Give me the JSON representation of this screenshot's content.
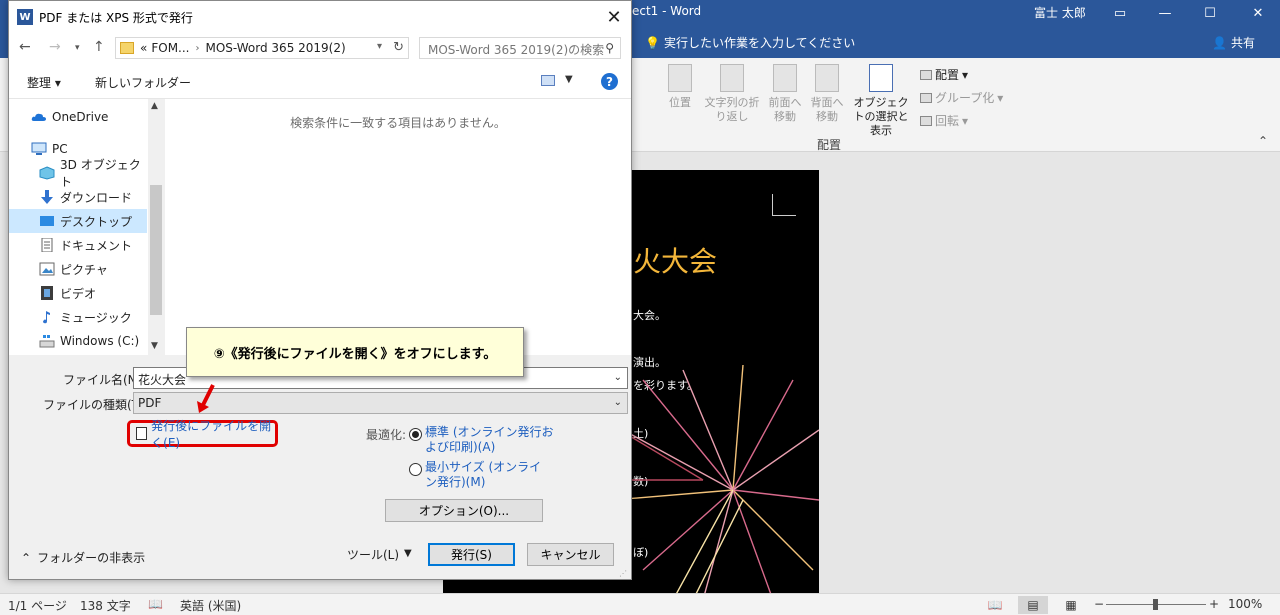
{
  "word": {
    "title": "ect1  -  Word",
    "user": "富士 太郎",
    "tell_me": "実行したい作業を入力してください",
    "share": "共有",
    "ribbon": {
      "position": "位置",
      "wrap_text": "文字列の折り返し",
      "bring_forward": "前面へ移動",
      "send_backward": "背面へ移動",
      "selection_pane": "オブジェクトの選択と表示",
      "align": "配置",
      "group": "グループ化",
      "rotate": "回転",
      "group_label": "配置"
    },
    "document": {
      "title": "火大会",
      "lines": [
        "大会。",
        "演出。",
        "を彩ります。",
        "土)",
        "数)",
        "ぼ)"
      ]
    },
    "status": {
      "page": "1/1 ページ",
      "words": "138 文字",
      "language": "英語 (米国)",
      "zoom": "100%"
    }
  },
  "dialog": {
    "title": "PDF または XPS 形式で発行",
    "address": {
      "prefix": "«",
      "crumb1": "FOM...",
      "crumb2": "MOS-Word 365 2019(2)"
    },
    "search_placeholder": "MOS-Word 365 2019(2)の検索",
    "toolbar": {
      "organize": "整理",
      "new_folder": "新しいフォルダー"
    },
    "tree": [
      {
        "label": "OneDrive",
        "icon": "cloud-icon"
      },
      {
        "label": "PC",
        "icon": "pc-icon"
      },
      {
        "label": "3D オブジェクト",
        "icon": "cube-icon"
      },
      {
        "label": "ダウンロード",
        "icon": "download-icon"
      },
      {
        "label": "デスクトップ",
        "icon": "desktop-icon"
      },
      {
        "label": "ドキュメント",
        "icon": "document-icon"
      },
      {
        "label": "ピクチャ",
        "icon": "picture-icon"
      },
      {
        "label": "ビデオ",
        "icon": "video-icon"
      },
      {
        "label": "ミュージック",
        "icon": "music-icon"
      },
      {
        "label": "Windows (C:)",
        "icon": "drive-icon"
      }
    ],
    "empty_message": "検索条件に一致する項目はありません。",
    "filename_label": "ファイル名(N):",
    "filename_value": "花火大会",
    "filetype_label": "ファイルの種類(T):",
    "filetype_value": "PDF",
    "open_after_publish": "発行後にファイルを開く(E)",
    "open_after_publish_checked": false,
    "optimize_label": "最適化:",
    "optimize_standard": "標準 (オンライン発行および印刷)(A)",
    "optimize_minimum": "最小サイズ (オンライン発行)(M)",
    "options_button": "オプション(O)...",
    "hide_folders": "フォルダーの非表示",
    "tools": "ツール(L)",
    "publish_button": "発行(S)",
    "cancel_button": "キャンセル"
  },
  "callout": {
    "text": "⑨《発行後にファイルを開く》をオフにします。"
  },
  "colors": {
    "word_blue": "#2b579a",
    "highlight_red": "#e00000",
    "callout_bg": "#ffffd9",
    "link_blue": "#1e5fbf"
  }
}
